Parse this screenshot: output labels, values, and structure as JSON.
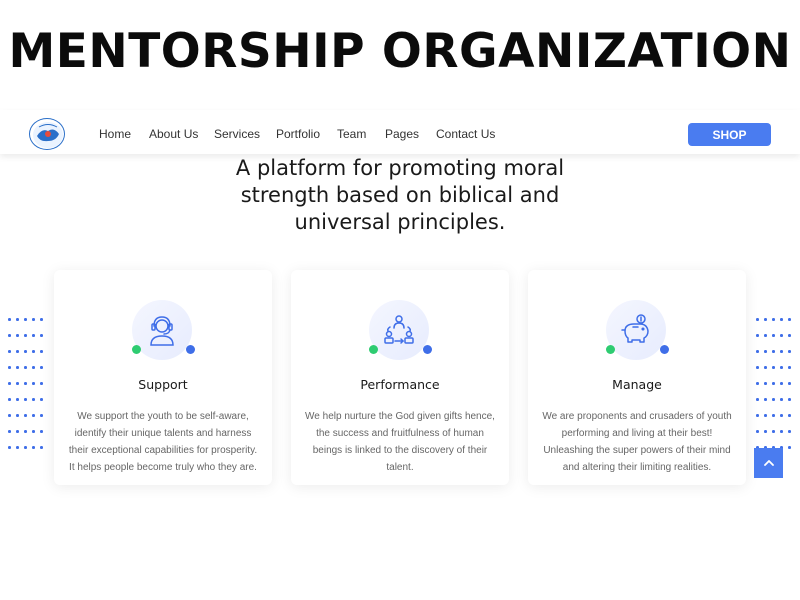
{
  "banner": {
    "title": "MENTORSHIP ORGANIZATION"
  },
  "nav": {
    "items": [
      "Home",
      "About Us",
      "Services",
      "Portfolio",
      "Team",
      "Pages",
      "Contact Us"
    ],
    "shop_label": "SHOP"
  },
  "hero": {
    "headline_lines": [
      "A platform for promoting moral",
      "strength based on biblical and",
      "universal principles."
    ]
  },
  "cards": [
    {
      "title": "Support",
      "icon": "headset-support-icon",
      "text_lines": [
        "We support the youth to be self-aware,",
        "identify their unique talents and harness",
        "their exceptional capabilities for prosperity.",
        "It helps people become truly who they are."
      ]
    },
    {
      "title": "Performance",
      "icon": "team-cycle-icon",
      "text_lines": [
        "We help nurture the God given gifts hence,",
        "the success and fruitfulness of human",
        "beings is linked to the discovery of their",
        "talent."
      ]
    },
    {
      "title": "Manage",
      "icon": "piggy-bank-icon",
      "text_lines": [
        "We are proponents and crusaders of youth",
        "performing and living at their best!",
        "Unleashing the super powers of their mind",
        "and altering their limiting realities."
      ]
    }
  ],
  "colors": {
    "accent": "#4a7cf0",
    "green": "#2ecc71",
    "dot_blue": "#3f6ee8"
  }
}
